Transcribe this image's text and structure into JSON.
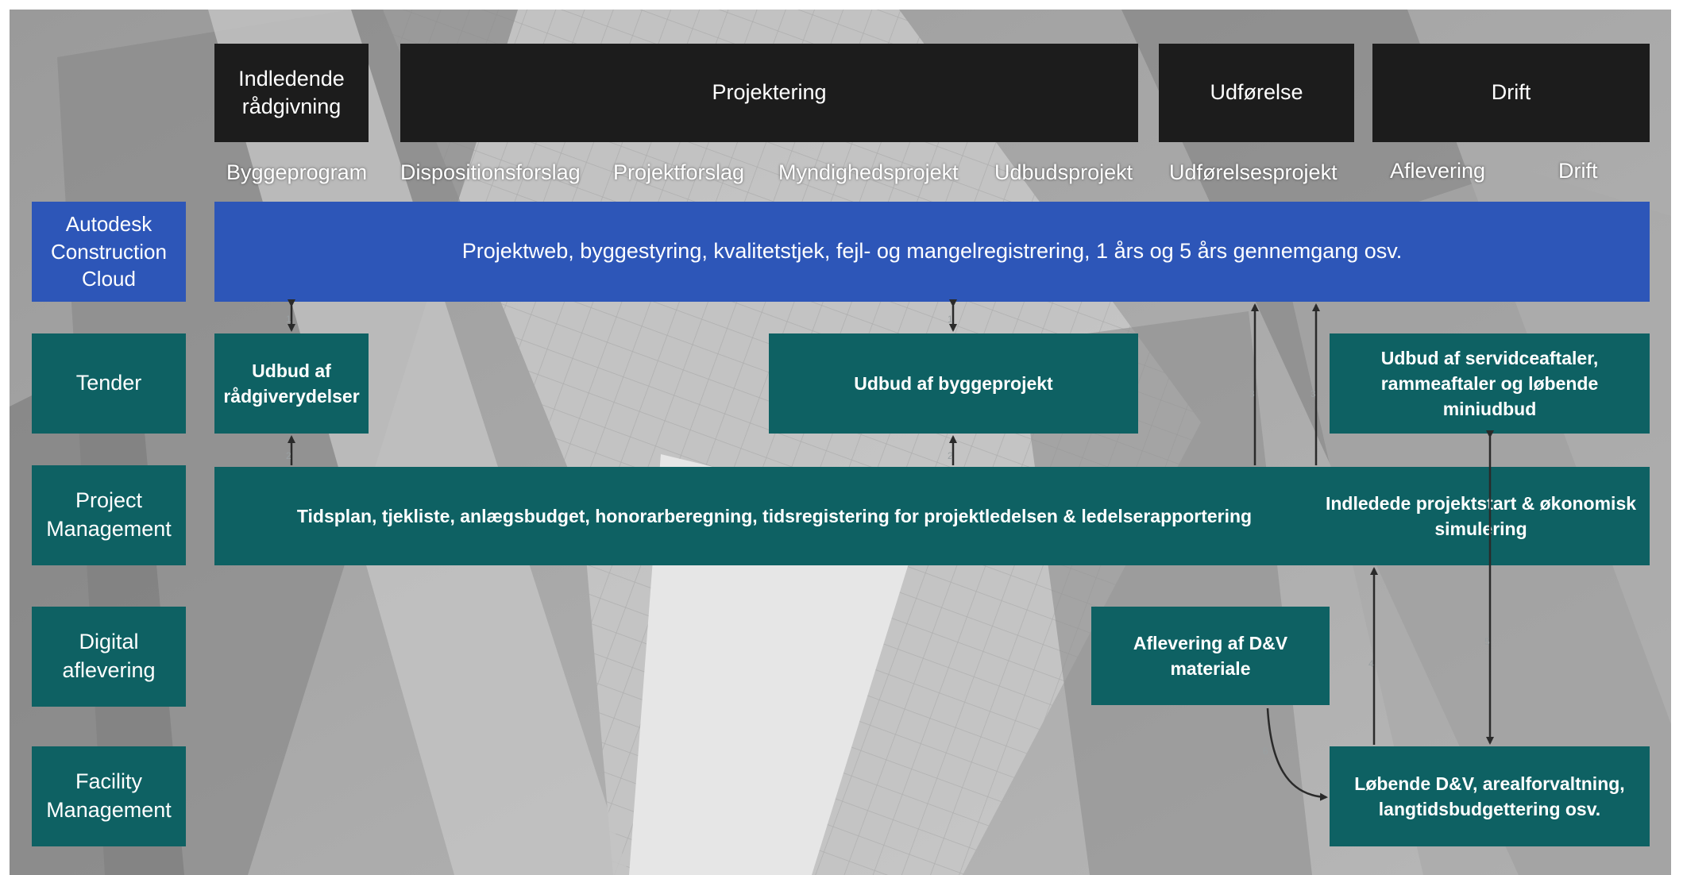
{
  "phases": {
    "indledende": "Indledende rådgivning",
    "projektering": "Projektering",
    "udforelse": "Udførelse",
    "drift": "Drift"
  },
  "stages": [
    "Byggeprogram",
    "Dispositionsforslag",
    "Projektforslag",
    "Myndighedsprojekt",
    "Udbudsprojekt",
    "Udførelsesprojekt",
    "Aflevering",
    "Drift"
  ],
  "rows": {
    "acc": "Autodesk Construction Cloud",
    "tender": "Tender",
    "pm": "Project Management",
    "digital": "Digital aflevering",
    "fm": "Facility Management"
  },
  "boxes": {
    "acc_bar": "Projektweb, byggestyring, kvalitetstjek, fejl- og mangelregistrering, 1 års og 5 års gennemgang osv.",
    "udbud_raadgiver": "Udbud af rådgiverydelser",
    "udbud_byggeprojekt": "Udbud af byggeprojekt",
    "udbud_service": "Udbud af servidceaftaler, rammeaftaler og løbende miniudbud",
    "pm_bar": "Tidsplan, tjekliste, anlægsbudget, honorarberegning, tidsregistering for projektledelsen & ledelserapportering",
    "pm_start": "Indledede projektstart & økonomisk simulering",
    "dv_aflevering": "Aflevering af D&V materiale",
    "fm_box": "Løbende D&V, arealforvaltning, langtidsbudgettering osv."
  },
  "colors": {
    "phase": "#1c1c1c",
    "teal": "#0e6163",
    "blue": "#2d56b8",
    "arrow": "#2a2a2a"
  }
}
